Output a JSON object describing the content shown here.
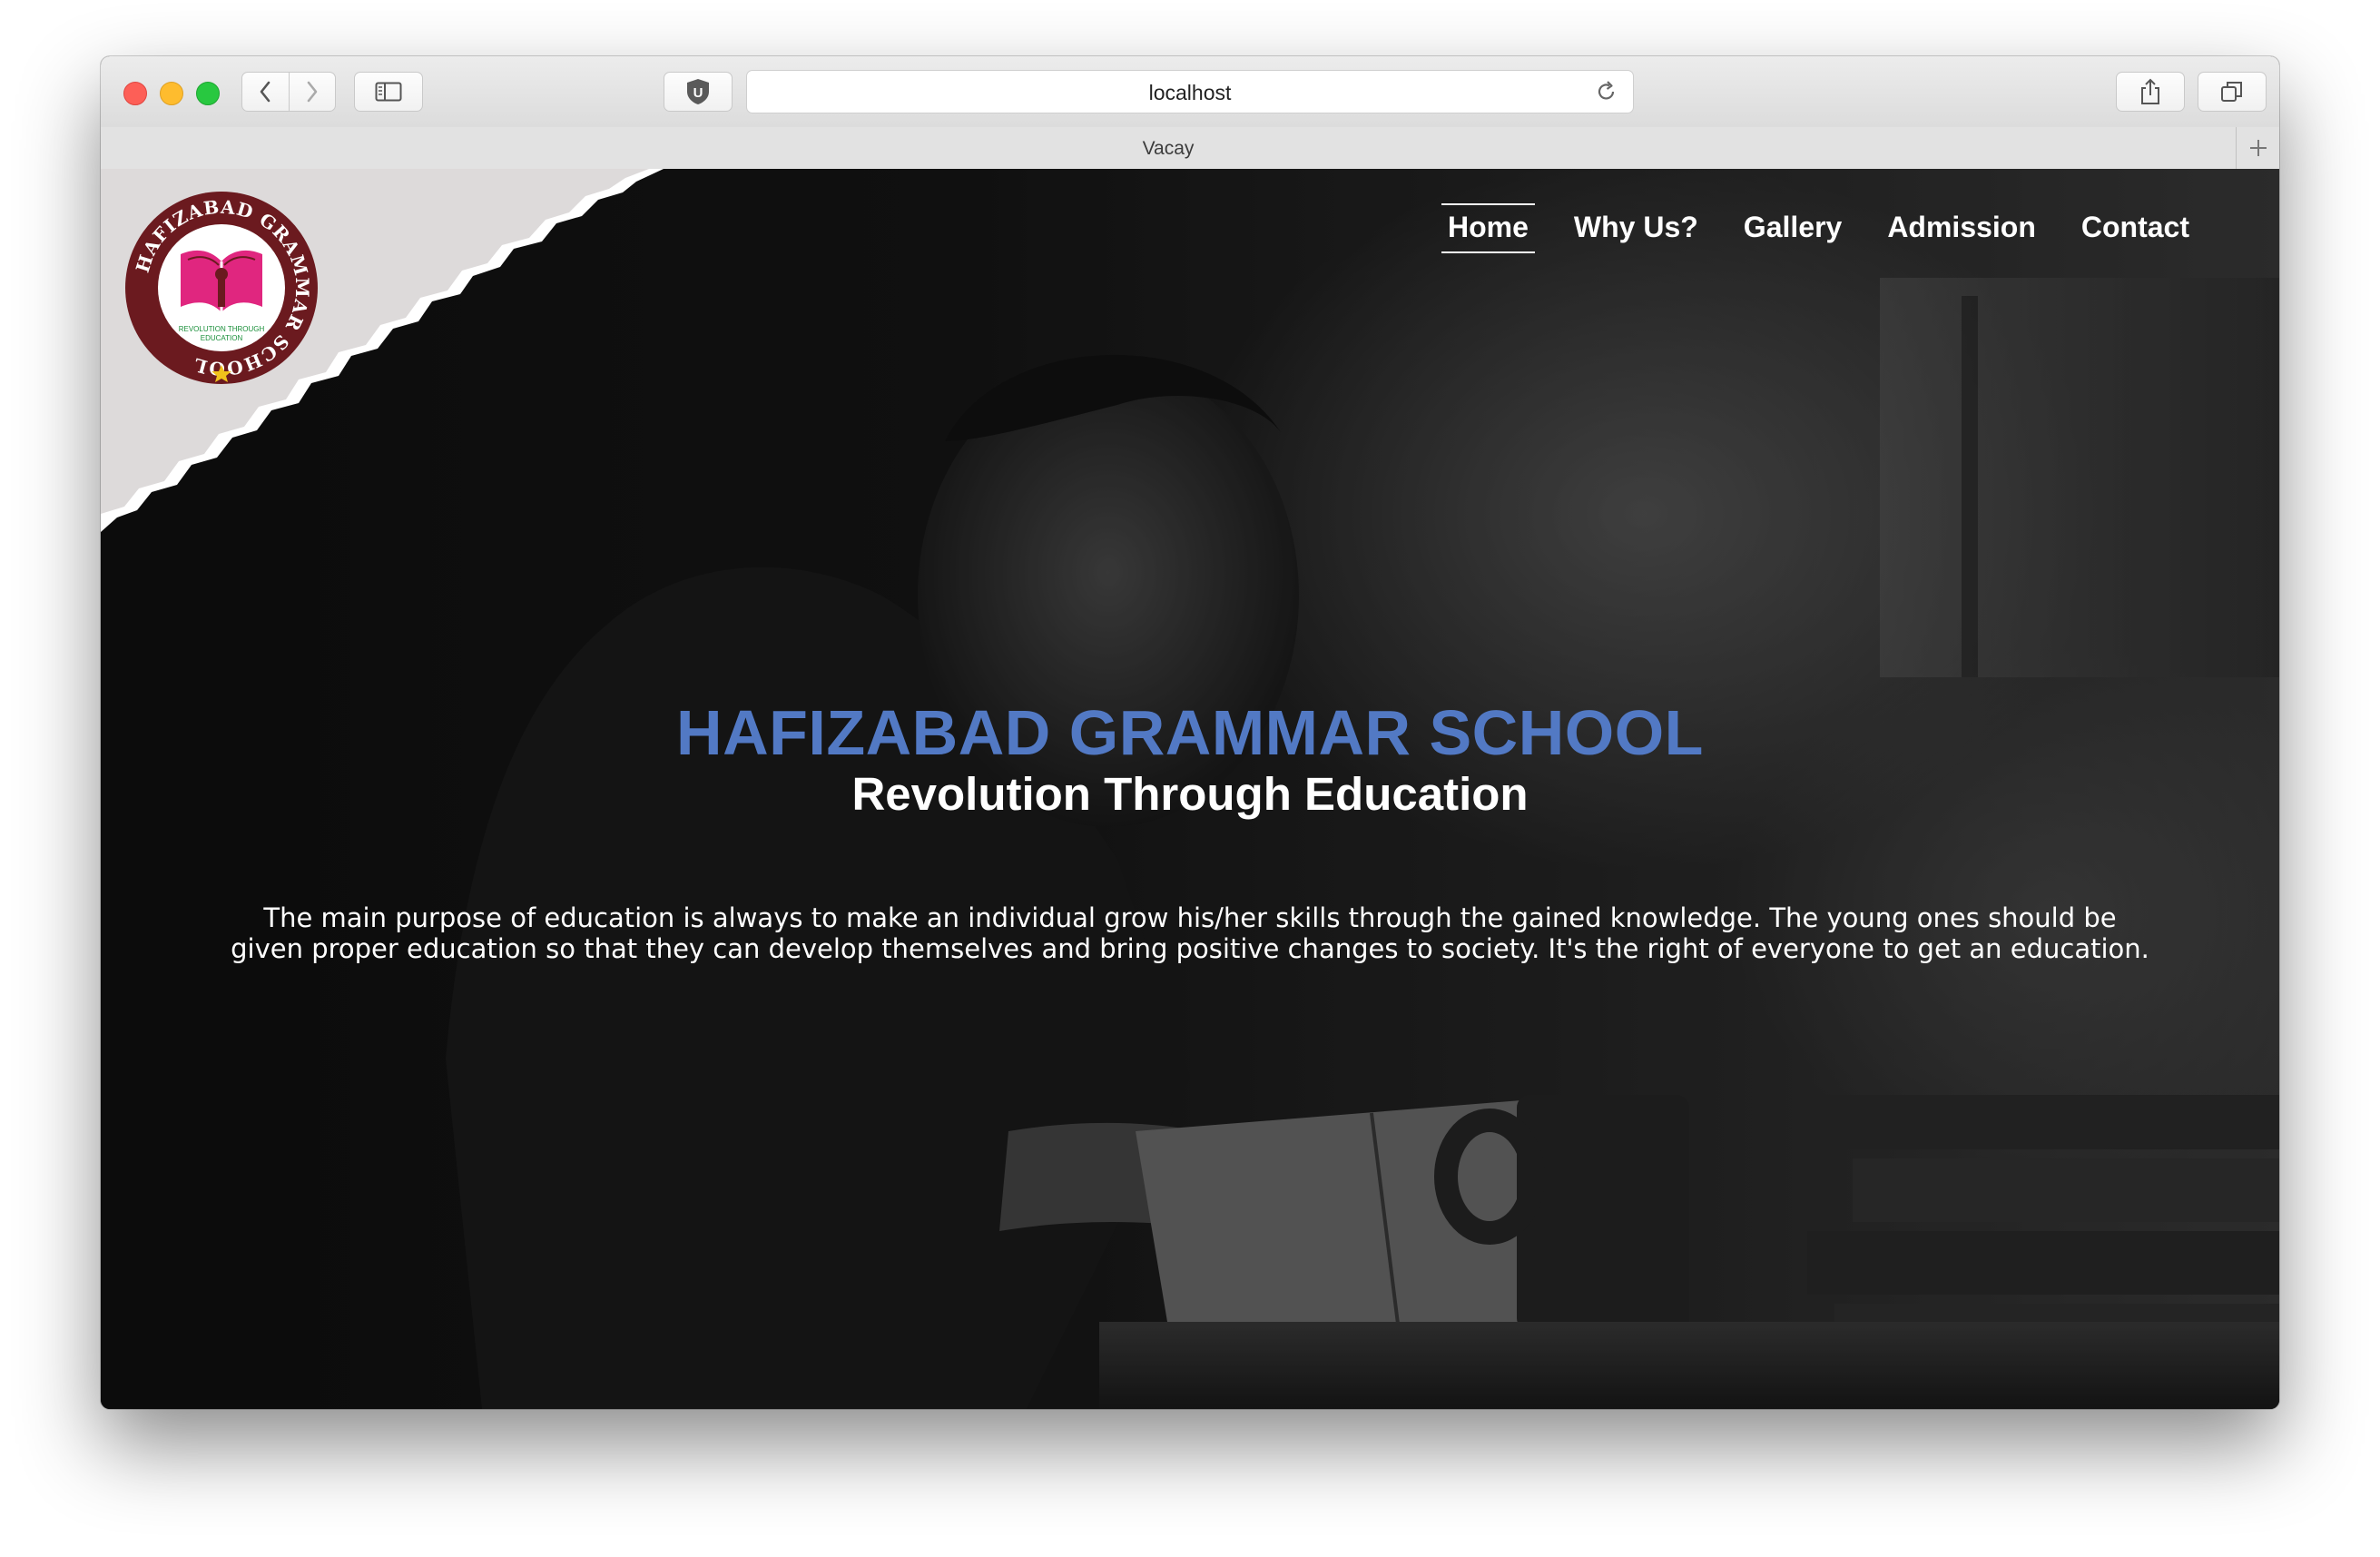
{
  "browser": {
    "url": "localhost",
    "tab_title": "Vacay",
    "shield_letter": "U"
  },
  "site": {
    "logo": {
      "ring_text": "HAFIZABAD GRAMMAR SCHOOL",
      "motto_line1": "REVOLUTION THROUGH",
      "motto_line2": "EDUCATION",
      "ring_color": "#6b1a1f",
      "book_color": "#e0267f"
    },
    "nav": [
      {
        "label": "Home",
        "active": true
      },
      {
        "label": "Why Us?",
        "active": false
      },
      {
        "label": "Gallery",
        "active": false
      },
      {
        "label": "Admission",
        "active": false
      },
      {
        "label": "Contact",
        "active": false
      }
    ],
    "hero": {
      "title": "HAFIZABAD GRAMMAR SCHOOL",
      "subtitle": "Revolution Through Education",
      "text": "The main purpose of education is always to make an individual grow his/her skills through the gained knowledge. The young ones should be given proper education so that they can develop themselves and bring positive changes to society. It's the right of everyone to get an education."
    },
    "colors": {
      "title_blue": "#5279c4",
      "corner_paper": "#dddada"
    }
  }
}
